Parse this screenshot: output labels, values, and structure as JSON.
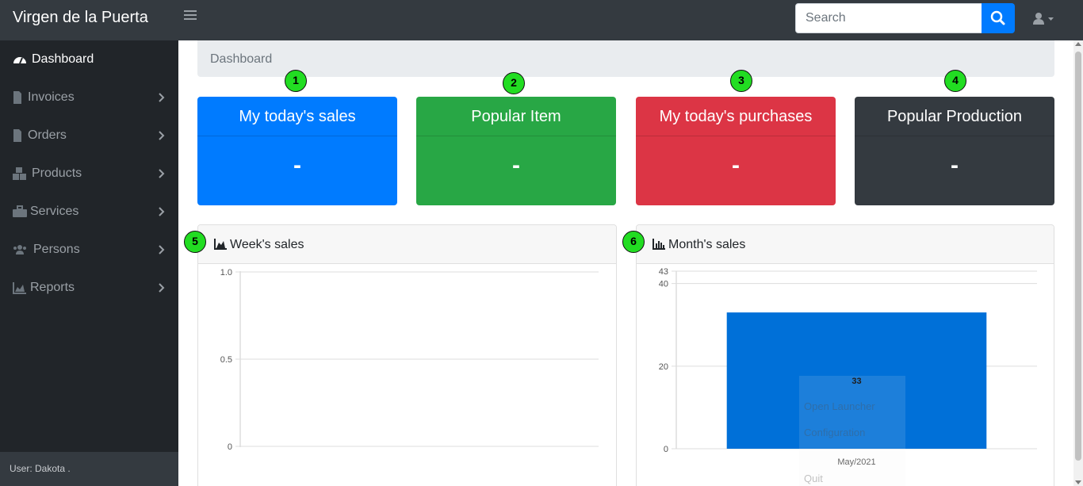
{
  "app": {
    "title": "Virgen de la Puerta"
  },
  "search": {
    "placeholder": "Search"
  },
  "sidebar": {
    "items": [
      {
        "label": "Dashboard",
        "icon": "tachometer-icon",
        "active": true
      },
      {
        "label": "Invoices",
        "icon": "invoice-icon"
      },
      {
        "label": "Orders",
        "icon": "order-icon"
      },
      {
        "label": "Products",
        "icon": "boxes-icon"
      },
      {
        "label": "Services",
        "icon": "toolbox-icon"
      },
      {
        "label": "Persons",
        "icon": "users-icon"
      },
      {
        "label": "Reports",
        "icon": "area-chart-icon"
      }
    ],
    "footer": "User: Dakota ."
  },
  "breadcrumb": {
    "current": "Dashboard"
  },
  "cards": [
    {
      "number": "1",
      "title": "My today's sales",
      "value": "-",
      "color": "#007bff"
    },
    {
      "number": "2",
      "title": "Popular Item",
      "value": "-",
      "color": "#28a745"
    },
    {
      "number": "3",
      "title": "My today's purchases",
      "value": "-",
      "color": "#dc3545"
    },
    {
      "number": "4",
      "title": "Popular Production",
      "value": "-",
      "color": "#343a40"
    }
  ],
  "panels": {
    "week": {
      "number": "5",
      "title": "Week's sales",
      "icon": "area-chart-icon"
    },
    "month": {
      "number": "6",
      "title": "Month's sales",
      "icon": "bar-chart-icon"
    }
  },
  "context_menu": {
    "items": [
      "Open Launcher",
      "Configuration",
      "Quit"
    ]
  },
  "chart_data": [
    {
      "type": "line",
      "title": "Week's sales",
      "yticks": [
        "1.0",
        "0.5",
        "0"
      ],
      "ylim": [
        0,
        1
      ],
      "series": [],
      "grid": true
    },
    {
      "type": "bar",
      "title": "Month's sales",
      "categories": [
        "May/2021"
      ],
      "values": [
        33
      ],
      "data_labels": [
        "33"
      ],
      "yticks": [
        "43",
        "40",
        "20",
        "0"
      ],
      "ylim": [
        0,
        43
      ],
      "bar_color": "#0070d8",
      "grid": true
    }
  ]
}
